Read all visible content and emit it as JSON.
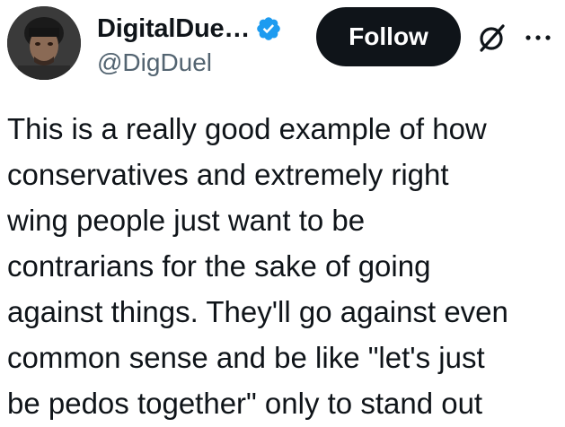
{
  "author": {
    "display_name": "DigitalDue…",
    "handle": "@DigDuel",
    "verified": true,
    "verified_color": "#1d9bf0"
  },
  "actions": {
    "follow_label": "Follow",
    "grok_icon": "grok-icon",
    "more_icon": "more-options-icon"
  },
  "tweet": {
    "text": "This is a really good example of how\nconservatives and extremely right\nwing people just want to be\ncontrarians for the sake of going\nagainst things. They'll go against even\ncommon sense and be like \"let's just\nbe pedos together\" only to stand out"
  },
  "colors": {
    "text": "#0f1419",
    "secondary": "#536471",
    "button_bg": "#0f1419",
    "button_text": "#ffffff"
  }
}
